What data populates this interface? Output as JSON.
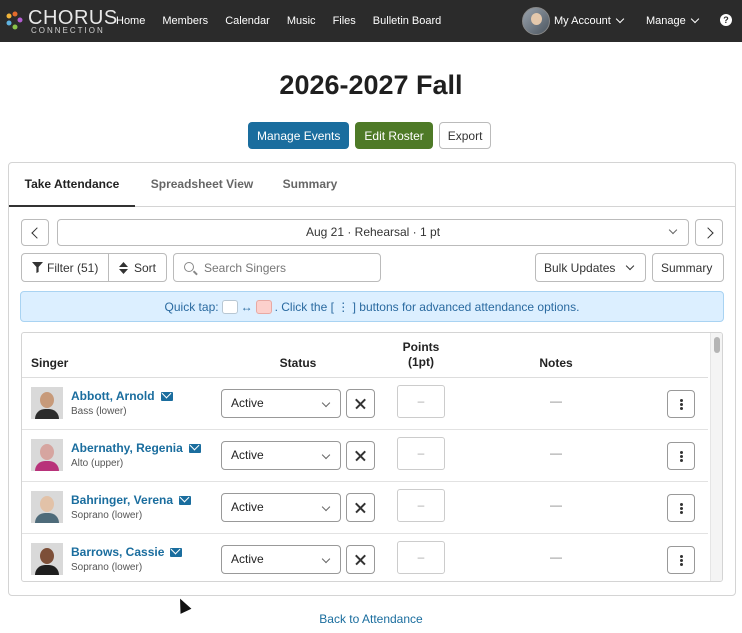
{
  "brand": {
    "name": "CHORUS",
    "sub": "CONNECTION"
  },
  "nav": [
    "Home",
    "Members",
    "Calendar",
    "Music",
    "Files",
    "Bulletin Board"
  ],
  "account": {
    "label": "My Account",
    "manage": "Manage",
    "help": "?"
  },
  "page_title": "2026-2027 Fall",
  "actions": {
    "manage_events": "Manage Events",
    "edit_roster": "Edit Roster",
    "export": "Export"
  },
  "tabs": [
    "Take Attendance",
    "Spreadsheet View",
    "Summary"
  ],
  "event_select": "Aug 21 · Rehearsal · 1 pt",
  "filter": {
    "filter_label": "Filter (51)",
    "sort_label": "Sort",
    "search_placeholder": "Search Singers",
    "bulk_label": "Bulk Updates",
    "summary_label": "Summary"
  },
  "quick_tap": {
    "prefix": "Quick tap:",
    "arrow": "↔",
    "suffix": ". Click the [ ⋮ ] buttons for advanced attendance options."
  },
  "table": {
    "headers": {
      "singer": "Singer",
      "status": "Status",
      "points": "Points",
      "points_sub": "(1pt)",
      "notes": "Notes"
    },
    "rows": [
      {
        "name": "Abbott, Arnold",
        "voice": "Bass (lower)",
        "status": "Active",
        "points": "–",
        "notes": "—",
        "skin": "#c79a7a",
        "shirt": "#2c2c2c"
      },
      {
        "name": "Abernathy, Regenia",
        "voice": "Alto (upper)",
        "status": "Active",
        "points": "–",
        "notes": "—",
        "skin": "#d6a5a0",
        "shirt": "#b8327a"
      },
      {
        "name": "Bahringer, Verena",
        "voice": "Soprano (lower)",
        "status": "Active",
        "points": "–",
        "notes": "—",
        "skin": "#e2c2a8",
        "shirt": "#4e6b7a"
      },
      {
        "name": "Barrows, Cassie",
        "voice": "Soprano (lower)",
        "status": "Active",
        "points": "–",
        "notes": "—",
        "skin": "#7d4f38",
        "shirt": "#1e1e1e"
      }
    ]
  },
  "back_link": "Back to Attendance"
}
